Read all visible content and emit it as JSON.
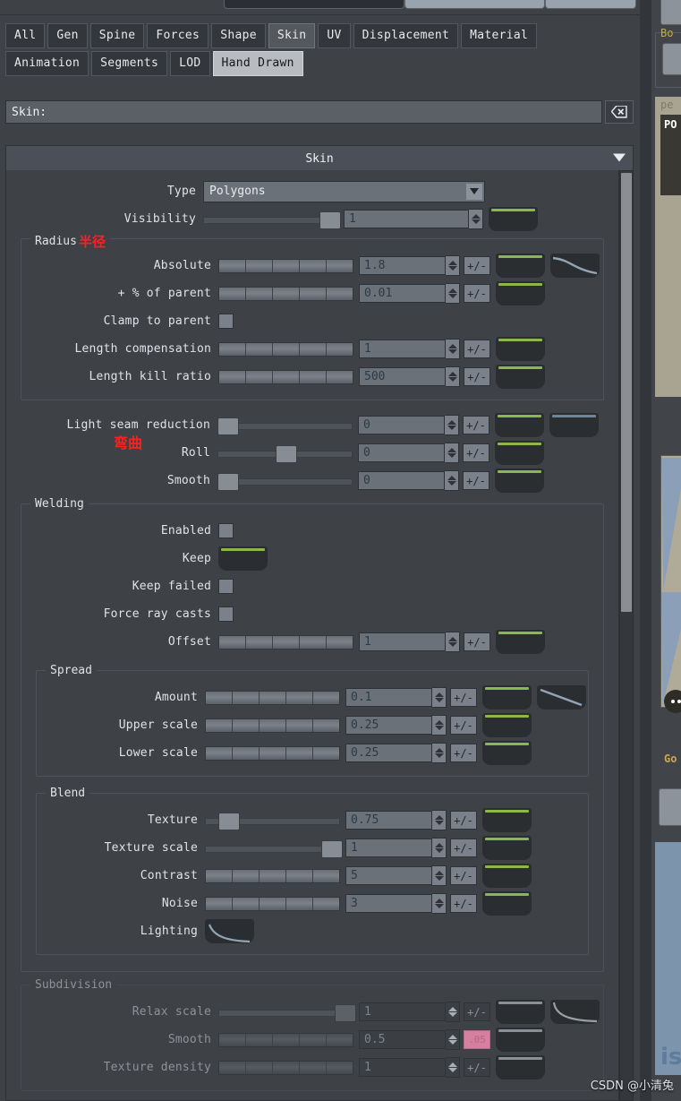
{
  "search": {
    "label": "Skin:",
    "value": "",
    "clear_icon": "clear-x-icon"
  },
  "tabs": {
    "row1": [
      {
        "label": "All",
        "state": "normal"
      },
      {
        "label": "Gen",
        "state": "normal"
      },
      {
        "label": "Spine",
        "state": "normal"
      },
      {
        "label": "Forces",
        "state": "normal"
      },
      {
        "label": "Shape",
        "state": "normal"
      },
      {
        "label": "Skin",
        "state": "selected"
      },
      {
        "label": "UV",
        "state": "normal"
      },
      {
        "label": "Displacement",
        "state": "normal"
      },
      {
        "label": "Material",
        "state": "normal"
      }
    ],
    "row2": [
      {
        "label": "Animation",
        "state": "normal"
      },
      {
        "label": "Segments",
        "state": "normal"
      },
      {
        "label": "LOD",
        "state": "normal"
      },
      {
        "label": "Hand Drawn",
        "state": "active"
      }
    ]
  },
  "panel": {
    "title": "Skin",
    "collapse_icon": "chevron-down-icon"
  },
  "type_row": {
    "label": "Type",
    "value": "Polygons",
    "dropdown_icon": "chevron-down-icon"
  },
  "visibility_row": {
    "label": "Visibility",
    "value": "1",
    "slider_pct": 88
  },
  "groups": {
    "radius": {
      "title": "Radius",
      "annotation": "半径",
      "rows": [
        {
          "label": "Absolute",
          "value": "1.8",
          "control": "segments",
          "plusminus": "+/-",
          "anim": "green",
          "curve": "ease-out-curve"
        },
        {
          "label": "+ % of parent",
          "value": "0.01",
          "control": "segments",
          "plusminus": "+/-",
          "anim": "green",
          "curve": null
        },
        {
          "label": "Clamp to parent",
          "value": null,
          "control": "checkbox",
          "checked": false
        },
        {
          "label": "Length compensation",
          "value": "1",
          "control": "segments",
          "plusminus": "+/-",
          "anim": "green",
          "curve": null
        },
        {
          "label": "Length kill ratio",
          "value": "500",
          "control": "segments",
          "plusminus": "+/-",
          "anim": "green",
          "curve": null
        }
      ]
    },
    "seam": {
      "annotation": "弯曲",
      "rows": [
        {
          "label": "Light seam reduction",
          "value": "0",
          "control": "slider",
          "slider_pct": 4,
          "plusminus": "+/-",
          "anim": "green",
          "extra": "blue"
        },
        {
          "label": "Roll",
          "value": "0",
          "control": "slider",
          "slider_pct": 46,
          "plusminus": "+/-",
          "anim": "green",
          "extra": null
        },
        {
          "label": "Smooth",
          "value": "0",
          "control": "slider",
          "slider_pct": 4,
          "plusminus": "+/-",
          "anim": "green",
          "extra": null
        }
      ]
    },
    "welding": {
      "title": "Welding",
      "rows": [
        {
          "label": "Enabled",
          "value": null,
          "control": "checkbox",
          "checked": false
        },
        {
          "label": "Keep",
          "value": null,
          "control": "anim",
          "anim": "green"
        },
        {
          "label": "Keep failed",
          "value": null,
          "control": "checkbox",
          "checked": false
        },
        {
          "label": "Force ray casts",
          "value": null,
          "control": "checkbox",
          "checked": false
        },
        {
          "label": "Offset",
          "value": "1",
          "control": "segments",
          "plusminus": "+/-",
          "anim": "green",
          "curve": null
        }
      ]
    },
    "spread": {
      "title": "Spread",
      "rows": [
        {
          "label": "Amount",
          "value": "0.1",
          "control": "segments",
          "plusminus": "+/-",
          "anim": "green",
          "curve": "linear-curve"
        },
        {
          "label": "Upper scale",
          "value": "0.25",
          "control": "segments",
          "plusminus": "+/-",
          "anim": "green",
          "curve": null
        },
        {
          "label": "Lower scale",
          "value": "0.25",
          "control": "segments",
          "plusminus": "+/-",
          "anim": "green",
          "curve": null
        }
      ]
    },
    "blend": {
      "title": "Blend",
      "rows": [
        {
          "label": "Texture",
          "value": "0.75",
          "control": "slider",
          "slider_pct": 12,
          "plusminus": "+/-",
          "anim": "green",
          "curve": null
        },
        {
          "label": "Texture scale",
          "value": "1",
          "control": "slider",
          "slider_pct": 88,
          "plusminus": "+/-",
          "anim": "green",
          "curve": null
        },
        {
          "label": "Contrast",
          "value": "5",
          "control": "segments",
          "plusminus": "+/-",
          "anim": "green",
          "curve": null
        },
        {
          "label": "Noise",
          "value": "3",
          "control": "segments",
          "plusminus": "+/-",
          "anim": "green",
          "curve": null
        },
        {
          "label": "Lighting",
          "value": null,
          "control": "curve",
          "curve": "ease-curve"
        }
      ]
    },
    "subdivision": {
      "title": "Subdivision",
      "disabled": true,
      "rows": [
        {
          "label": "Relax scale",
          "value": "1",
          "control": "slider",
          "slider_pct": 88,
          "plusminus": "+/-",
          "anim": "grey",
          "curve": "ease-out-curve"
        },
        {
          "label": "Smooth",
          "value": "0.5",
          "control": "segments",
          "plusminus": ".05",
          "pink": true,
          "anim": "grey",
          "curve": null
        },
        {
          "label": "Texture density",
          "value": "1",
          "control": "segments",
          "plusminus": "+/-",
          "anim": "grey",
          "curve": null
        }
      ]
    }
  },
  "right_panel": {
    "group_label": "Bo",
    "tab_label": "pe",
    "dark_label": "PO",
    "bottom_label": "Go",
    "big_word": "isio"
  },
  "watermark": "CSDN @小清兔",
  "colors": {
    "accent_green": "#8ab84a",
    "pink": "#d4809e",
    "panel_bg": "#3e4247",
    "annotation_red": "#ff2020"
  }
}
